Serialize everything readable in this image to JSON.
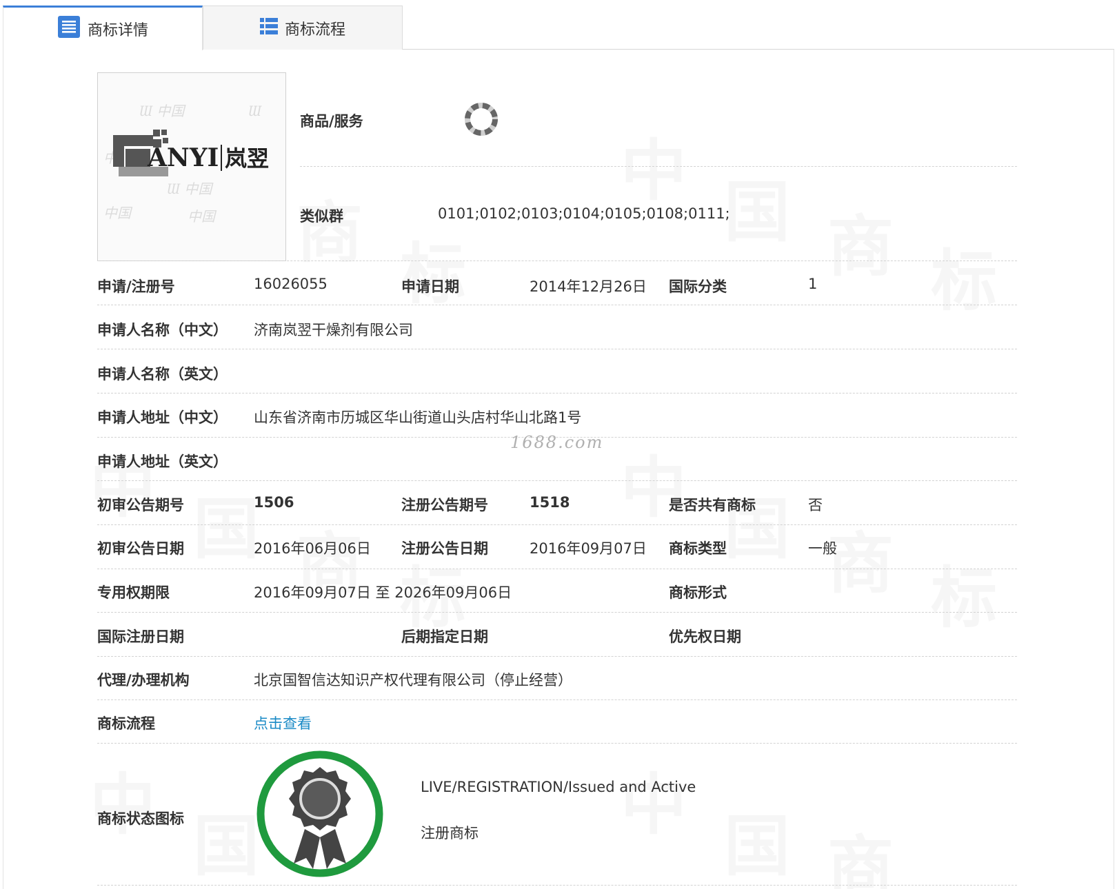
{
  "tabs": {
    "detail": "商标详情",
    "flow": "商标流程"
  },
  "logo": {
    "text_en": "ANYI",
    "text_cn": "岚翌"
  },
  "goods": {
    "label": "商品/服务"
  },
  "similar": {
    "label": "类似群",
    "value": "0101;0102;0103;0104;0105;0108;0111;"
  },
  "rows": {
    "reg_no": {
      "label": "申请/注册号",
      "value": "16026055"
    },
    "apply_date": {
      "label": "申请日期",
      "value": "2014年12月26日"
    },
    "intl_class": {
      "label": "国际分类",
      "value": "1"
    },
    "applicant_cn": {
      "label": "申请人名称（中文）",
      "value": "济南岚翌干燥剂有限公司"
    },
    "applicant_en": {
      "label": "申请人名称（英文）",
      "value": ""
    },
    "address_cn": {
      "label": "申请人地址（中文）",
      "value": "山东省济南市历城区华山街道山头店村华山北路1号"
    },
    "address_en": {
      "label": "申请人地址（英文）",
      "value": ""
    },
    "prelim_issue": {
      "label": "初审公告期号",
      "value": "1506"
    },
    "reg_issue": {
      "label": "注册公告期号",
      "value": "1518"
    },
    "shared": {
      "label": "是否共有商标",
      "value": "否"
    },
    "prelim_date": {
      "label": "初审公告日期",
      "value": "2016年06月06日"
    },
    "reg_date": {
      "label": "注册公告日期",
      "value": "2016年09月07日"
    },
    "tm_type": {
      "label": "商标类型",
      "value": "一般"
    },
    "exclusive": {
      "label": "专用权期限",
      "value": "2016年09月07日 至 2026年09月06日"
    },
    "tm_form": {
      "label": "商标形式",
      "value": ""
    },
    "intl_reg_date": {
      "label": "国际注册日期",
      "value": ""
    },
    "later_date": {
      "label": "后期指定日期",
      "value": ""
    },
    "priority_date": {
      "label": "优先权日期",
      "value": ""
    },
    "agent": {
      "label": "代理/办理机构",
      "value": "北京国智信达知识产权代理有限公司（停止经营）"
    },
    "flow": {
      "label": "商标流程",
      "value": "点击查看"
    },
    "status": {
      "label": "商标状态图标",
      "status_en": "LIVE/REGISTRATION/Issued and Active",
      "status_cn": "注册商标"
    }
  },
  "watermark_site": "1688.com",
  "colors": {
    "tab_accent": "#3b7fd8",
    "link": "#1a8ac6",
    "badge_ring": "#1f9a3e",
    "badge_medal": "#444444"
  }
}
